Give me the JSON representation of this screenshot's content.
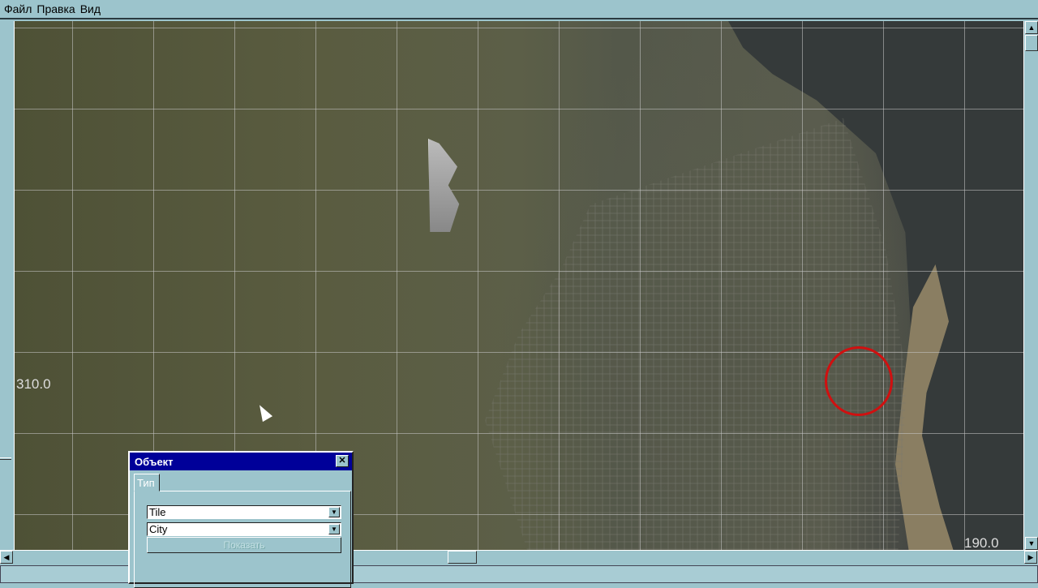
{
  "menu": {
    "items": [
      "Файл",
      "Правка",
      "Вид"
    ]
  },
  "map": {
    "labels": {
      "left": "310.0",
      "right": "190.0"
    }
  },
  "dialog": {
    "title": "Объект",
    "tab": "Тип",
    "type_value": "Tile",
    "subtype_value": "City",
    "show_button": "Показать"
  },
  "colors": {
    "dialog_title": "#000099",
    "highlight_circle": "#d01010",
    "chrome": "#9cc4cc"
  }
}
